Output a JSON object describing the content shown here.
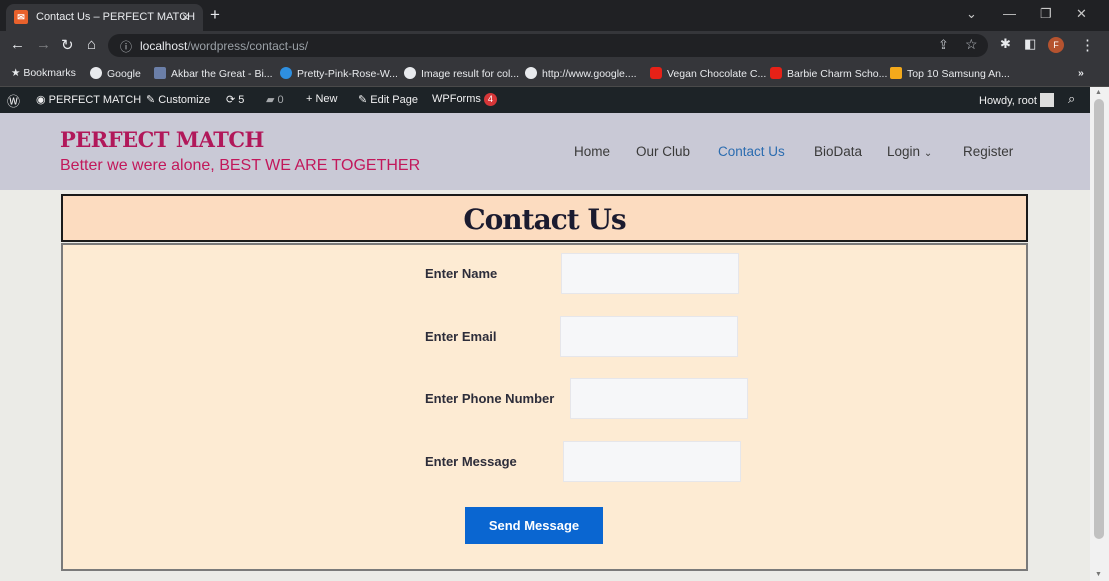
{
  "browser": {
    "tab_title": "Contact Us – PERFECT MATCH",
    "tab_close": "×",
    "new_tab": "+",
    "url_host": "localhost",
    "url_path": "/wordpress/contact-us/",
    "profile_initial": "F",
    "bookmarks": [
      {
        "label": "Bookmarks",
        "icon": "star-icon",
        "color": "#e8eaed"
      },
      {
        "label": "Google",
        "icon": "google-icon",
        "color": "#e8eaed"
      },
      {
        "label": "Akbar the Great - Bi...",
        "icon": "bio-icon",
        "color": "#6b7fa8"
      },
      {
        "label": "Pretty-Pink-Rose-W...",
        "icon": "rose-icon",
        "color": "#2e8fe0"
      },
      {
        "label": "Image result for col...",
        "icon": "image-icon",
        "color": "#e8eaed"
      },
      {
        "label": "http://www.google....",
        "icon": "google-icon",
        "color": "#e8eaed"
      },
      {
        "label": "Vegan Chocolate C...",
        "icon": "youtube-icon",
        "color": "#e62117"
      },
      {
        "label": "Barbie Charm Scho...",
        "icon": "youtube-icon",
        "color": "#e62117"
      },
      {
        "label": "Top 10 Samsung An...",
        "icon": "91-icon",
        "color": "#f3a91b"
      }
    ],
    "more_bookmarks": "»"
  },
  "adminbar": {
    "site_name": "PERFECT MATCH",
    "customize": "Customize",
    "updates": "5",
    "comments": "0",
    "new": "New",
    "edit_page": "Edit Page",
    "wpforms": "WPForms",
    "wpforms_count": "4",
    "howdy": "Howdy, root"
  },
  "header": {
    "site_title": "PERFECT MATCH",
    "tagline": "Better we were alone, BEST WE ARE TOGETHER",
    "nav": [
      "Home",
      "Our Club",
      "Contact Us",
      "BioData",
      "Login",
      "Register"
    ],
    "active_nav": "Contact Us",
    "accent_color": "#b1185a"
  },
  "main": {
    "heading": "Contact Us",
    "fields": [
      {
        "label": "Enter Name",
        "value": ""
      },
      {
        "label": "Enter Email",
        "value": ""
      },
      {
        "label": "Enter Phone Number",
        "value": ""
      },
      {
        "label": "Enter Message",
        "value": ""
      }
    ],
    "submit_label": "Send Message",
    "submit_color": "#0a66d1"
  }
}
